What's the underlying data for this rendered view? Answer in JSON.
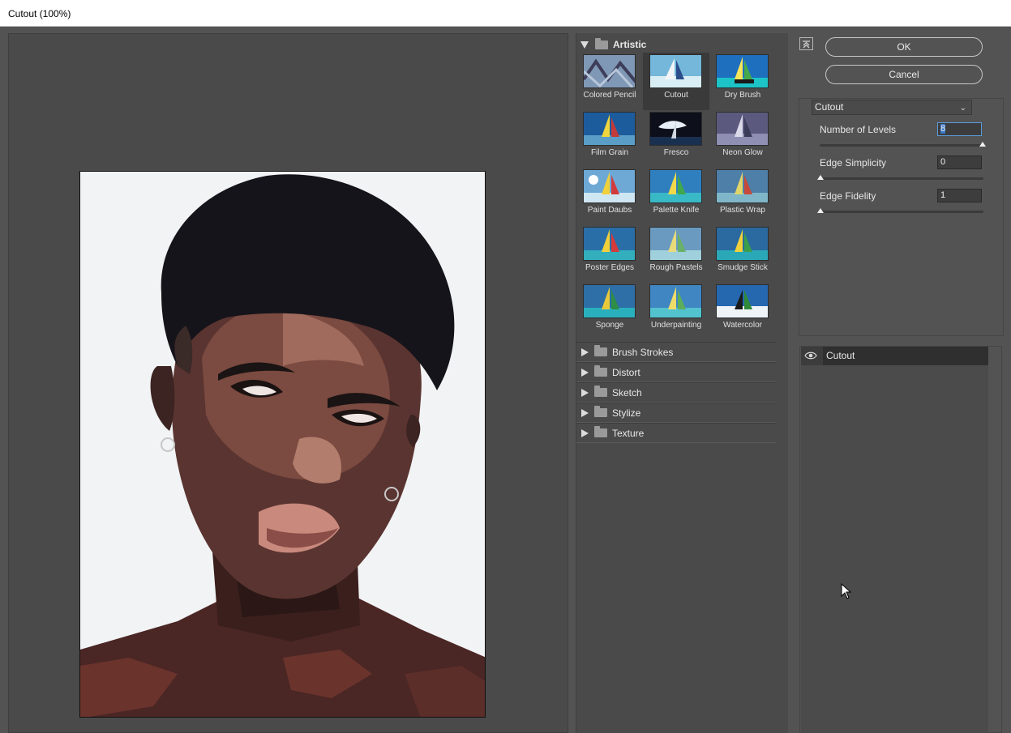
{
  "window": {
    "title": "Cutout (100%)"
  },
  "gallery": {
    "open_group": "Artistic",
    "filters": [
      {
        "label": "Colored Pencil"
      },
      {
        "label": "Cutout"
      },
      {
        "label": "Dry Brush"
      },
      {
        "label": "Film Grain"
      },
      {
        "label": "Fresco"
      },
      {
        "label": "Neon Glow"
      },
      {
        "label": "Paint Daubs"
      },
      {
        "label": "Palette Knife"
      },
      {
        "label": "Plastic Wrap"
      },
      {
        "label": "Poster Edges"
      },
      {
        "label": "Rough Pastels"
      },
      {
        "label": "Smudge Stick"
      },
      {
        "label": "Sponge"
      },
      {
        "label": "Underpainting"
      },
      {
        "label": "Watercolor"
      }
    ],
    "selected_filter": "Cutout",
    "closed_groups": [
      {
        "label": "Brush Strokes"
      },
      {
        "label": "Distort"
      },
      {
        "label": "Sketch"
      },
      {
        "label": "Stylize"
      },
      {
        "label": "Texture"
      }
    ]
  },
  "buttons": {
    "ok": "OK",
    "cancel": "Cancel"
  },
  "settings": {
    "filter_select": "Cutout",
    "params": [
      {
        "label": "Number of Levels",
        "value": "8",
        "slider_fraction": 1.0
      },
      {
        "label": "Edge Simplicity",
        "value": "0",
        "slider_fraction": 0.0
      },
      {
        "label": "Edge Fidelity",
        "value": "1",
        "slider_fraction": 0.0
      }
    ]
  },
  "layers": {
    "items": [
      {
        "label": "Cutout"
      }
    ]
  },
  "icons": {
    "collapse": "collapse-panel-icon",
    "eye": "eye-icon",
    "folder": "folder-icon",
    "cursor": "mouse-pointer-icon"
  },
  "colors": {
    "background": "#535353",
    "selected_thumb": "#3a3a3a",
    "input_focus": "#5a9bdc"
  }
}
